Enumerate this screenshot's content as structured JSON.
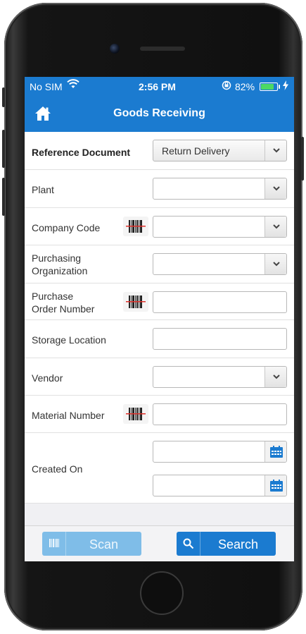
{
  "status_bar": {
    "carrier": "No SIM",
    "time": "2:56 PM",
    "battery_percent": "82%",
    "battery_level": 0.82,
    "wifi_icon": "wifi-icon",
    "orientation_lock_icon": "orientation-lock-icon",
    "charging_icon": "charging-bolt-icon"
  },
  "nav": {
    "title": "Goods Receiving",
    "home_icon": "home-icon"
  },
  "form": {
    "reference_document": {
      "label": "Reference Document",
      "value": "Return Delivery"
    },
    "plant": {
      "label": "Plant",
      "value": ""
    },
    "company_code": {
      "label": "Company Code",
      "value": ""
    },
    "purchasing_org": {
      "label_line1": "Purchasing",
      "label_line2": "Organization",
      "value": ""
    },
    "purchase_order": {
      "label_line1": "Purchase",
      "label_line2": "Order Number",
      "value": ""
    },
    "storage_location": {
      "label": "Storage Location",
      "value": ""
    },
    "vendor": {
      "label": "Vendor",
      "value": ""
    },
    "material_number": {
      "label": "Material Number",
      "value": ""
    },
    "created_on": {
      "label": "Created On",
      "from": "",
      "to": ""
    }
  },
  "toolbar": {
    "scan_label": "Scan",
    "search_label": "Search"
  },
  "colors": {
    "brand_blue": "#1b7bd0",
    "scan_button_disabled": "#7fbde8",
    "battery_green": "#4cd964"
  }
}
